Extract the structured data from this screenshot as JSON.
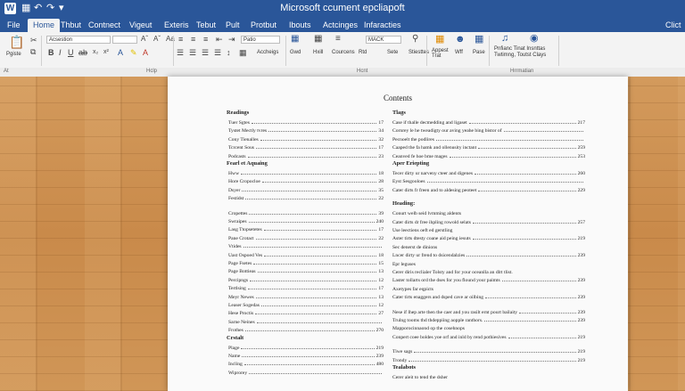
{
  "window": {
    "title": "Microsoft ccument epcliapoft",
    "app_icon": "W"
  },
  "quick_access": [
    "save-icon",
    "undo-icon",
    "redo-icon",
    "customize-icon"
  ],
  "titlebar_right": "",
  "tabs": [
    "File",
    "Home",
    "Thbut",
    "Contnect",
    "Vigeut",
    "Exteris",
    "Tebut",
    "Pult",
    "Protbut",
    "Ibouts",
    "Actcinges",
    "Infaracties"
  ],
  "tab_right": "Clict",
  "ribbon": {
    "paste_label": "Pgiste",
    "font_name": "Acsestion",
    "font_size": "",
    "style_box": "Patio",
    "styles_label": "Accheigs",
    "group_a": "Gwd",
    "group_b": "Hxill",
    "group_c": "Courcens",
    "group_d": "Rtd",
    "group_e": "Sete",
    "group_f": "Stiesttes",
    "group_g": "Appest Trat",
    "group_h": "Wff",
    "font_box2": "MACK",
    "pase": "Pase",
    "phr_label": "Pnfianc Tinat Insnttas",
    "phr_label2": "Twtimng, Toutst Clays"
  },
  "group_labels": {
    "a": "At",
    "b": "Hclp",
    "c": "Hcnt",
    "d": "Hrrmatian"
  },
  "document": {
    "title": "Contents",
    "left": [
      {
        "type": "sec",
        "text": "Readings"
      },
      {
        "label": "Tuer Sgtes",
        "page": "17"
      },
      {
        "label": "Tystet Mectly tvres",
        "page": "34"
      },
      {
        "label": "Cony Tienalles",
        "page": "32"
      },
      {
        "label": "Tcrcent Sous",
        "page": "17"
      },
      {
        "label": "Podcasts",
        "page": "23"
      },
      {
        "type": "sec",
        "text": "Fearl et Aquaing"
      },
      {
        "label": "Hww",
        "page": "18"
      },
      {
        "label": "Hore Cropocloe",
        "page": "28"
      },
      {
        "label": "Dsyer",
        "page": "35"
      },
      {
        "label": "Festidst",
        "page": "22"
      },
      {
        "type": "gap"
      },
      {
        "label": "Cropettes",
        "page": "39"
      },
      {
        "label": "Swraipes",
        "page": "240"
      },
      {
        "label": "Lasg Ttopsetetes",
        "page": "17"
      },
      {
        "label": "Pane Crotact",
        "page": "22"
      },
      {
        "label": "Vtides",
        "page": ""
      },
      {
        "label": "Uast Ospoed Ves",
        "page": "18"
      },
      {
        "label": "Page Fsetes",
        "page": "15"
      },
      {
        "label": "Page Bottieas",
        "page": "13"
      },
      {
        "label": "Percipngs",
        "page": "12"
      },
      {
        "label": "Tertlsing",
        "page": "17"
      },
      {
        "label": "Meyr Newes",
        "page": "13"
      },
      {
        "label": "Leaser Sogedas",
        "page": "12"
      },
      {
        "label": "Hese Proctis",
        "page": "27"
      },
      {
        "label": "Sarne Neines",
        "page": ""
      },
      {
        "label": "Frothes",
        "page": "270"
      },
      {
        "type": "sec",
        "text": "Crstalt"
      },
      {
        "label": "Plage",
        "page": "219"
      },
      {
        "label": "Name",
        "page": "239"
      },
      {
        "label": "Incling",
        "page": "480"
      },
      {
        "label": "Wiprorey",
        "page": ""
      }
    ],
    "right": [
      {
        "type": "sec",
        "text": "Tlags"
      },
      {
        "label": "Case if thalle decmedding and ligaset",
        "page": "217"
      },
      {
        "label": "Cornrey le he tweadigty our aving yeahe bing bistor of",
        "page": ""
      },
      {
        "label": "Pecnoelt the podlires",
        "page": ""
      },
      {
        "label": "Caaped the fa hamk and ollenusity inctant",
        "page": "259"
      },
      {
        "label": "Ceanved fe hoe bme mages",
        "page": "253"
      },
      {
        "type": "sec",
        "text": "Aper Eriepting"
      },
      {
        "label": "Tecer dirty ur narveny cteer and digenes",
        "page": "260"
      },
      {
        "label": "Eyst Sesgooloes",
        "page": ""
      },
      {
        "label": "Cater dirts fr freen and to aldesing peoteet",
        "page": "229"
      },
      {
        "type": "gap"
      },
      {
        "type": "sec",
        "text": "Heading:"
      },
      {
        "label": "Conurt welb seid lvmming aldents",
        "page": "",
        "nodots": true
      },
      {
        "label": "Cater dirts dr free ihpling rowold selats",
        "page": "257"
      },
      {
        "label": "Use leectiens oeft ed gerstling",
        "page": "",
        "nodots": true
      },
      {
        "label": "Aster tirts dtesty coane aid peing iesuts",
        "page": "219"
      },
      {
        "label": "Sec denerst de dinions",
        "page": "",
        "nodots": true
      },
      {
        "label": "Lncer dirty ur frend to dsicendalzies",
        "page": "239"
      },
      {
        "label": "Epr leguses",
        "page": "",
        "nodots": true
      },
      {
        "label": "Cerer diris reclialer Tolsty and for your oceanlla an dlrt tlist.",
        "page": "",
        "nodots": true
      },
      {
        "label": "Laster tollarts ord the dses for you flound your paimts",
        "page": "239"
      },
      {
        "label": "Axetypes far eqpicts",
        "page": "",
        "nodots": true
      },
      {
        "label": "Cater tirts enaggers and dsped cave ar oilbing",
        "page": "239"
      },
      {
        "type": "gap"
      },
      {
        "label": "Nese if lhep arte then the caer and you rasilt ernt pourt bailaity",
        "page": "239"
      },
      {
        "label": "Trulng tooms thd thdeppiing aopple ranthors.",
        "page": "239"
      },
      {
        "label": "Mapporocinnaond op the cosehnops",
        "page": "",
        "nodots": true
      },
      {
        "label": "Conpert coee boldes yoe orf and inld by rend pothiesives",
        "page": "219"
      },
      {
        "type": "gap"
      },
      {
        "label": "Tiwe sags",
        "page": "219"
      },
      {
        "label": "Trondy",
        "page": "219"
      },
      {
        "type": "sec",
        "text": "Tealabots"
      },
      {
        "label": "Cerer aleit to tend the dsher",
        "page": "",
        "nodots": true
      }
    ]
  }
}
